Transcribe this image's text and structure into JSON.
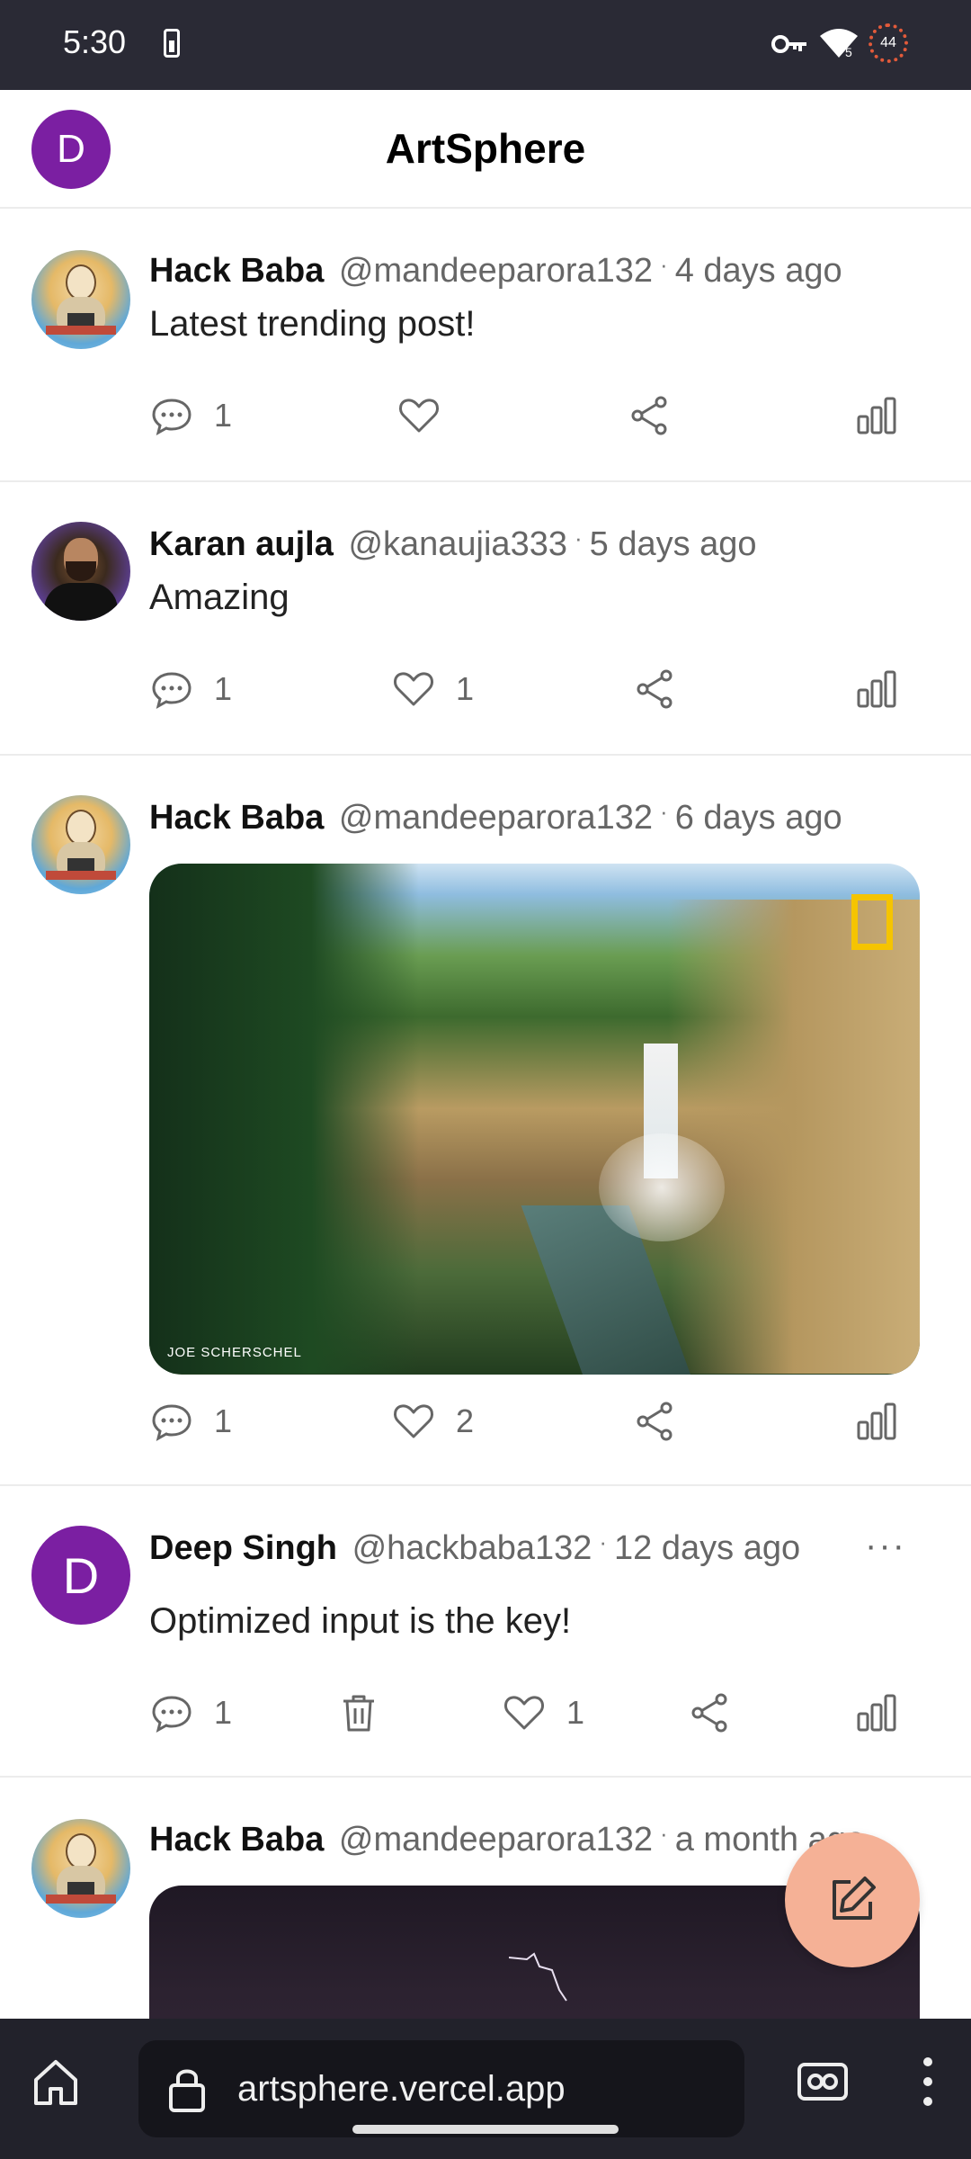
{
  "status_bar": {
    "time": "5:30",
    "wifi_badge": "5",
    "battery_level": "44"
  },
  "app": {
    "title": "ArtSphere",
    "user_initial": "D"
  },
  "posts": [
    {
      "author": "Hack Baba",
      "handle": "@mandeeparora132",
      "time": "4 days ago",
      "text": "Latest trending post!",
      "comments": "1",
      "likes": ""
    },
    {
      "author": "Karan aujla",
      "handle": "@kanaujia333",
      "time": "5 days ago",
      "text": "Amazing",
      "comments": "1",
      "likes": "1"
    },
    {
      "author": "Hack Baba",
      "handle": "@mandeeparora132",
      "time": "6 days ago",
      "image_credit": "JOE SCHERSCHEL",
      "comments": "1",
      "likes": "2"
    },
    {
      "author": "Deep Singh",
      "handle": "@hackbaba132",
      "time": "12 days ago",
      "initial": "D",
      "text": "Optimized input is the key!",
      "comments": "1",
      "likes": "1",
      "more": "···"
    },
    {
      "author": "Hack Baba",
      "handle": "@mandeeparora132",
      "time": "a month ago"
    }
  ],
  "browser": {
    "url": "artsphere.vercel.app"
  },
  "colors": {
    "avatar_purple": "#7b1fa2",
    "fab": "#f5b196",
    "icon_gray": "#666666"
  }
}
